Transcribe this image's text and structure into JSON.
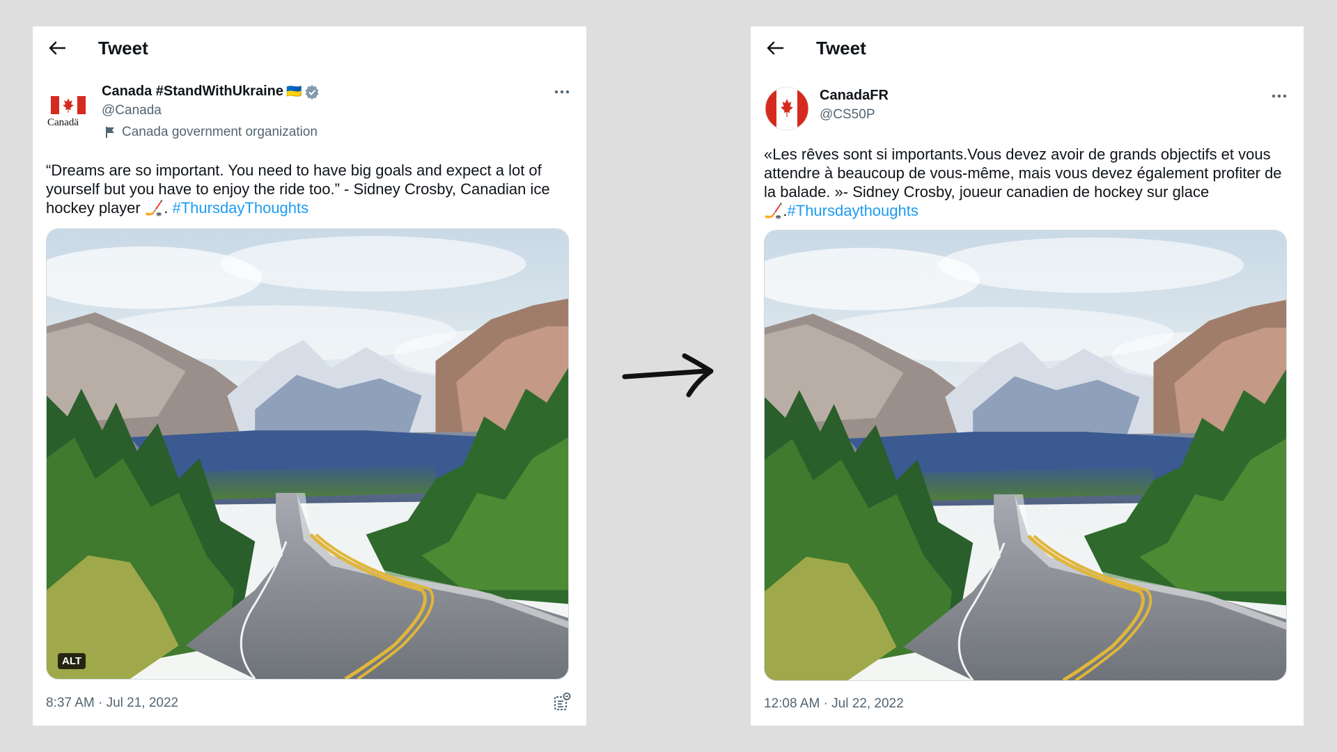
{
  "left_tweet": {
    "header_title": "Tweet",
    "display_name": "Canada #StandWithUkraine",
    "flag_emoji": "🇺🇦",
    "handle": "@Canada",
    "org_label": "Canada government organization",
    "logo_wordmark": "Canadä",
    "text_main": "“Dreams are so important. You need to have big goals and expect a lot of yourself but you have to enjoy the ride too.” - Sidney Crosby, Canadian ice hockey player 🏒. ",
    "hashtag": "#ThursdayThoughts",
    "alt_badge": "ALT",
    "timestamp": "8:37 AM · Jul 21, 2022"
  },
  "right_tweet": {
    "header_title": "Tweet",
    "display_name": "CanadaFR",
    "handle": "@CS50P",
    "text_main": "«Les rêves sont si importants.Vous devez avoir de grands objectifs et vous attendre à beaucoup de vous-même, mais vous devez également profiter de la balade. »- Sidney Crosby, joueur canadien de hockey sur glace 🏒.",
    "hashtag": "#Thursdaythoughts",
    "timestamp": "12:08 AM · Jul 22, 2022"
  },
  "colors": {
    "background": "#dedede",
    "panel": "#ffffff",
    "link": "#1d9bf0",
    "canada_red": "#d52b1e",
    "verified_gray": "#829aab"
  },
  "icons": [
    "back-arrow-icon",
    "verified-badge-icon",
    "more-icon",
    "flag-icon",
    "stats-icon",
    "transition-arrow-icon"
  ]
}
